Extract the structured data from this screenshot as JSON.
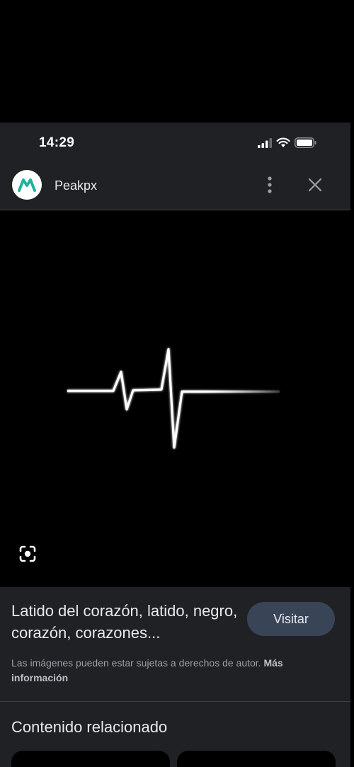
{
  "status_bar": {
    "time": "14:29"
  },
  "header": {
    "site_name": "Peakpx",
    "logo_icon": "peakpx-logo-icon"
  },
  "result": {
    "title": "Latido del corazón, latido, negro, corazón, corazones...",
    "visit_label": "Visitar",
    "copyright_text": "Las imágenes pueden estar sujetas a derechos de autor.",
    "more_info_label": "Más información"
  },
  "related": {
    "heading": "Contenido relacionado"
  },
  "colors": {
    "brand_logo": "#1fb39a",
    "visit_button": "#394457",
    "panel_bg": "#202124"
  }
}
